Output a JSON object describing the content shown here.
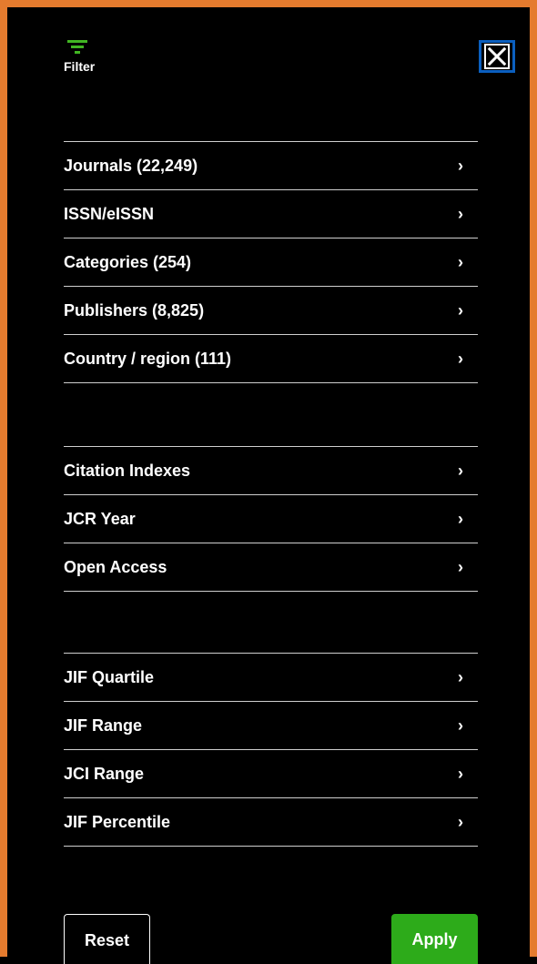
{
  "header": {
    "filter_label": "Filter",
    "filter_icon": "filter-icon",
    "close_icon": "close-icon"
  },
  "groups": [
    {
      "items": [
        {
          "label": "Journals (22,249)",
          "chevron": "›"
        },
        {
          "label": "ISSN/eISSN",
          "chevron": "›"
        },
        {
          "label": "Categories (254)",
          "chevron": "›"
        },
        {
          "label": "Publishers (8,825)",
          "chevron": "›"
        },
        {
          "label": "Country / region (111)",
          "chevron": "›"
        }
      ]
    },
    {
      "items": [
        {
          "label": "Citation Indexes",
          "chevron": "›"
        },
        {
          "label": "JCR Year",
          "chevron": "›"
        },
        {
          "label": "Open Access",
          "chevron": "›"
        }
      ]
    },
    {
      "items": [
        {
          "label": "JIF Quartile",
          "chevron": "›"
        },
        {
          "label": "JIF Range",
          "chevron": "›"
        },
        {
          "label": "JCI Range",
          "chevron": "›"
        },
        {
          "label": "JIF Percentile",
          "chevron": "›"
        }
      ]
    }
  ],
  "footer": {
    "reset_label": "Reset",
    "apply_label": "Apply"
  },
  "colors": {
    "frame_border": "#e57b2e",
    "accent_green": "#2dab1a",
    "filter_icon_green": "#41b623",
    "close_focus_blue": "#0b5fbf",
    "background": "#000000"
  }
}
